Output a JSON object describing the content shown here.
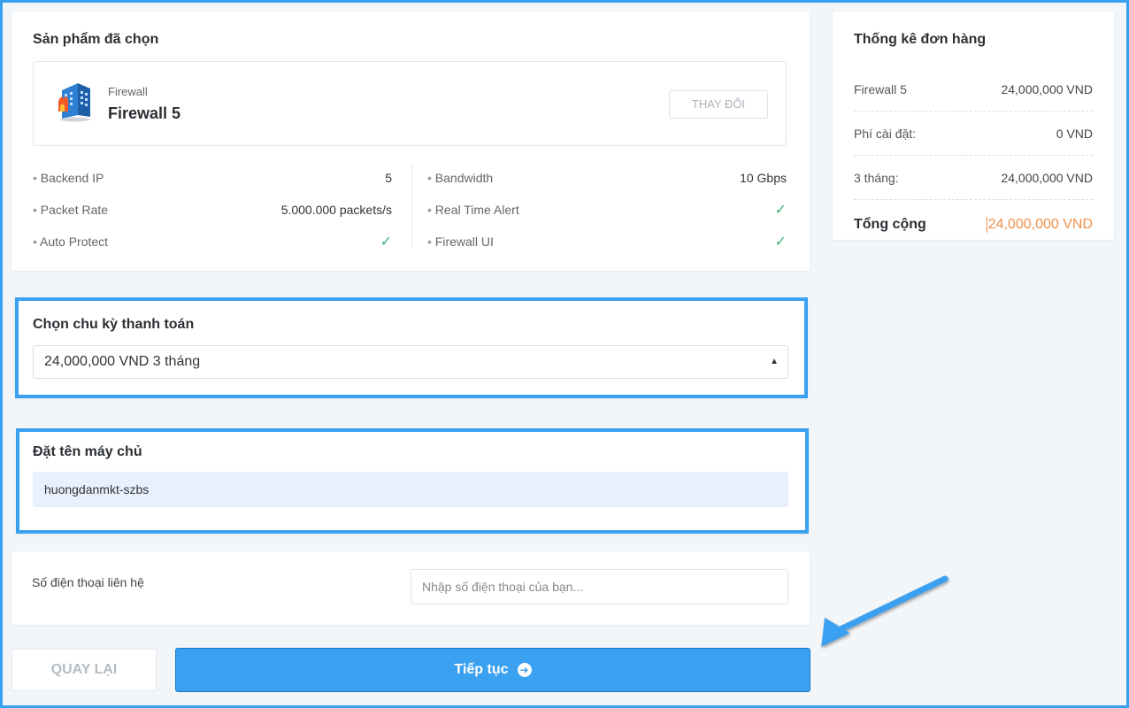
{
  "selected_product": {
    "title": "Sản phẩm đã chọn",
    "category": "Firewall",
    "name": "Firewall 5",
    "change_button": "THAY ĐỔI",
    "specs_left": [
      {
        "label": "Backend IP",
        "value": "5"
      },
      {
        "label": "Packet Rate",
        "value": "5.000.000 packets/s"
      },
      {
        "label": "Auto Protect",
        "value": "check"
      }
    ],
    "specs_right": [
      {
        "label": "Bandwidth",
        "value": "10 Gbps"
      },
      {
        "label": "Real Time Alert",
        "value": "check"
      },
      {
        "label": "Firewall UI",
        "value": "check"
      }
    ],
    "icon": "firewall-building-icon"
  },
  "billing": {
    "title": "Chọn chu kỳ thanh toán",
    "selected_option": "24,000,000 VND 3 tháng"
  },
  "server_name": {
    "title": "Đặt tên máy chủ",
    "value": "huongdanmkt-szbs"
  },
  "phone": {
    "label": "Số điện thoại liên hệ",
    "placeholder": "Nhập số điện thoại của bạn..."
  },
  "footer": {
    "back_label": "QUAY LẠI",
    "continue_label": "Tiếp tục"
  },
  "summary": {
    "title": "Thống kê đơn hàng",
    "rows": [
      {
        "label": "Firewall 5",
        "value": "24,000,000 VND"
      },
      {
        "label": "Phí cài đặt:",
        "value": "0 VND"
      },
      {
        "label": "3 tháng:",
        "value": "24,000,000 VND"
      }
    ],
    "total_label": "Tổng cộng",
    "total_value": "24,000,000 VND"
  },
  "colors": {
    "accent": "#3aa0f0",
    "check": "#3cb878",
    "total": "#f0914a",
    "background": "#f3f6f9"
  }
}
